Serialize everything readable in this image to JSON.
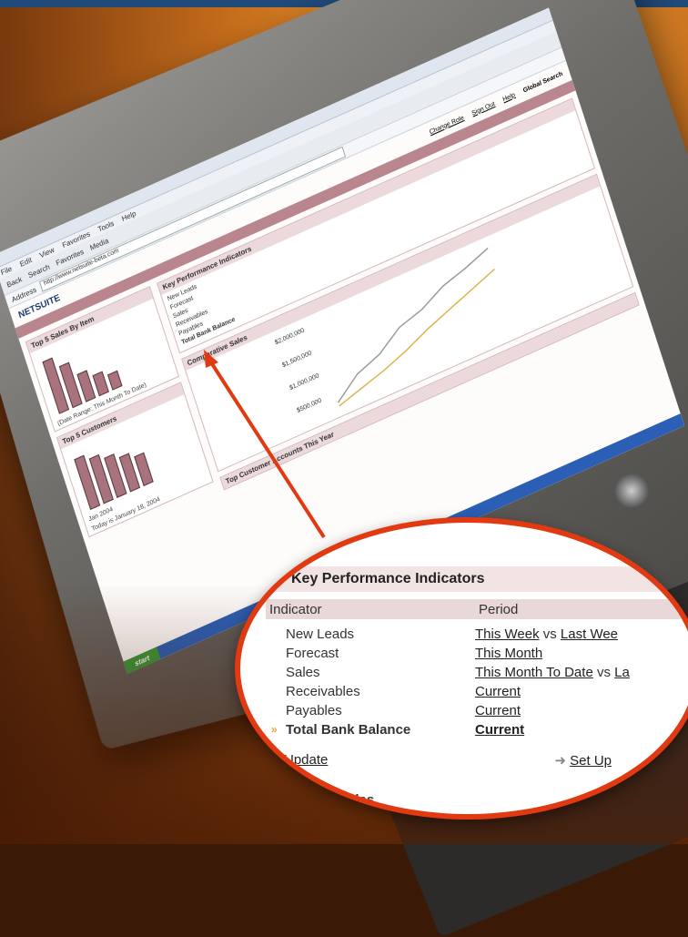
{
  "browser": {
    "menu": [
      "File",
      "Edit",
      "View",
      "Favorites",
      "Tools",
      "Help"
    ],
    "toolbar": [
      "Back",
      "Search",
      "Favorites",
      "Media"
    ],
    "address_label": "Address",
    "address_value": "http://www.netsuite-beta.com"
  },
  "netsuite": {
    "logo": "NETSUITE",
    "top_links": [
      "Change Role",
      "Sign Out",
      "Help",
      "Global Search"
    ],
    "left_portlets": [
      "Top 5 Sales By Item",
      "Top 5 Customers"
    ],
    "left_footer": "(Date Range: This Month To Date)",
    "calendar_month": "Jan 2004",
    "today": "Today is January 18, 2004",
    "center_portlets": [
      "Key Performance Indicators",
      "Comparative Sales",
      "Top Customer Accounts This Year"
    ],
    "chart_ticks": [
      "$2,000,000",
      "$1,500,000",
      "$1,000,000",
      "$500,000"
    ]
  },
  "kpi": {
    "title": "Key Performance Indicators",
    "col_indicator": "Indicator",
    "col_period": "Period",
    "rows": [
      {
        "indicator": "New Leads",
        "period_a": "This Week",
        "vs": "vs",
        "period_b": "Last Wee"
      },
      {
        "indicator": "Forecast",
        "period_a": "This Month",
        "vs": "",
        "period_b": ""
      },
      {
        "indicator": "Sales",
        "period_a": "This Month To Date",
        "vs": "vs",
        "period_b": "La"
      },
      {
        "indicator": "Receivables",
        "period_a": "Current",
        "vs": "",
        "period_b": ""
      },
      {
        "indicator": "Payables",
        "period_a": "Current",
        "vs": "",
        "period_b": ""
      },
      {
        "indicator": "Total Bank Balance",
        "period_a": "Current",
        "vs": "",
        "period_b": ""
      }
    ],
    "update": "Update",
    "setup": "Set Up",
    "next_section": "Sales"
  },
  "colors": {
    "callout": "#e13a12",
    "header_tint": "#f3e4e4",
    "netsuite_nav": "#b9868e"
  }
}
